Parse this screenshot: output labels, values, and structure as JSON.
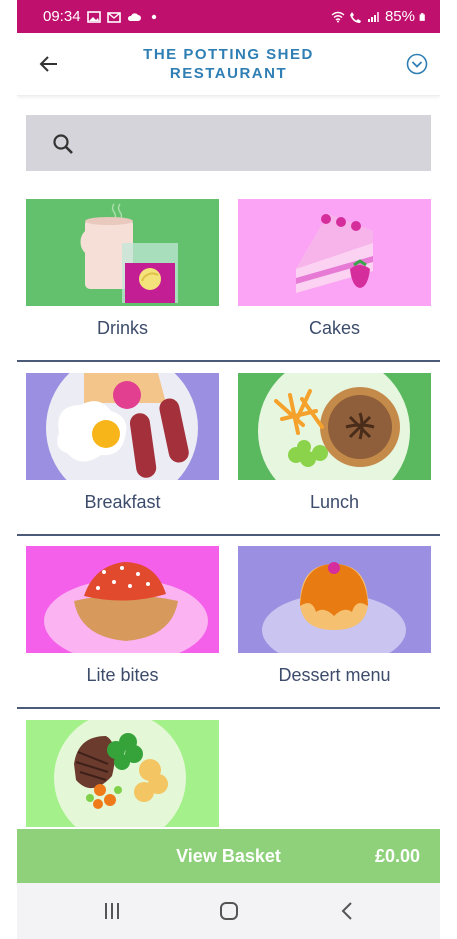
{
  "status_bar": {
    "time": "09:34",
    "battery": "85%"
  },
  "header": {
    "title_line1": "THE POTTING SHED",
    "title_line2": "RESTAURANT"
  },
  "search": {
    "placeholder": ""
  },
  "categories": [
    {
      "label": "Drinks"
    },
    {
      "label": "Cakes"
    },
    {
      "label": "Breakfast"
    },
    {
      "label": "Lunch"
    },
    {
      "label": "Lite bites"
    },
    {
      "label": "Dessert menu"
    },
    {
      "label": ""
    }
  ],
  "basket": {
    "label": "View Basket",
    "total": "£0.00"
  },
  "colors": {
    "status_bar": "#c0106e",
    "title": "#2f7fb4",
    "basket": "#8fd17b",
    "label": "#3d4c6b"
  },
  "icons": [
    "back-arrow-icon",
    "chevron-down-circle-icon",
    "search-icon",
    "recents-icon",
    "home-icon",
    "back-nav-icon"
  ]
}
